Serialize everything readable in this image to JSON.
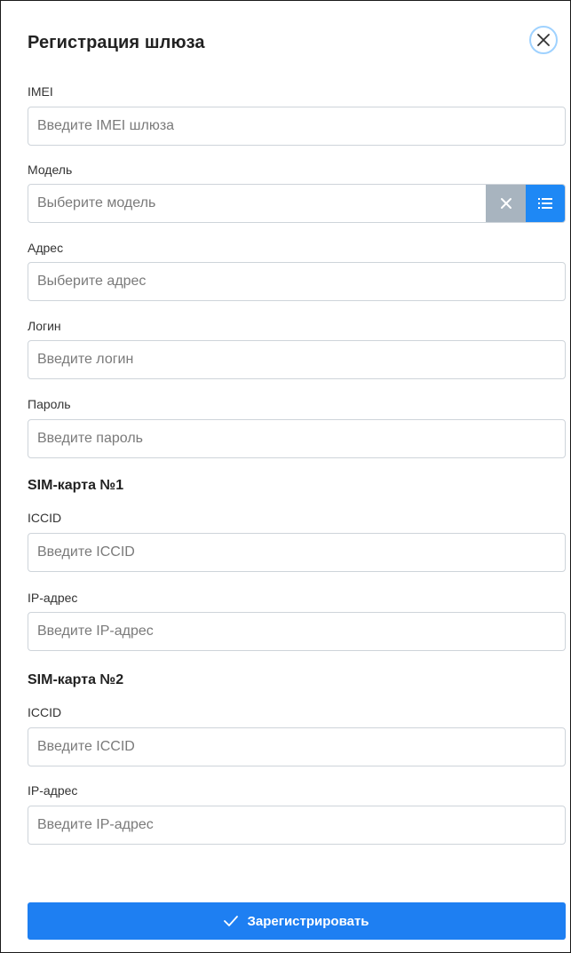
{
  "dialog": {
    "title": "Регистрация шлюза",
    "close_icon": "close-icon"
  },
  "fields": {
    "imei": {
      "label": "IMEI",
      "placeholder": "Введите IMEI шлюза",
      "value": ""
    },
    "model": {
      "label": "Модель",
      "placeholder": "Выберите модель",
      "clear_icon": "close-icon",
      "list_icon": "list-icon"
    },
    "address": {
      "label": "Адрес",
      "placeholder": "Выберите адрес",
      "value": ""
    },
    "login": {
      "label": "Логин",
      "placeholder": "Введите логин",
      "value": ""
    },
    "password": {
      "label": "Пароль",
      "placeholder": "Введите пароль",
      "value": ""
    }
  },
  "sim1": {
    "title": "SIM-карта №1",
    "iccid": {
      "label": "ICCID",
      "placeholder": "Введите ICCID",
      "value": ""
    },
    "ip": {
      "label": "IP-адрес",
      "placeholder": "Введите IP-адрес",
      "value": ""
    }
  },
  "sim2": {
    "title": "SIM-карта №2",
    "iccid": {
      "label": "ICCID",
      "placeholder": "Введите ICCID",
      "value": ""
    },
    "ip": {
      "label": "IP-адрес",
      "placeholder": "Введите IP-адрес",
      "value": ""
    }
  },
  "submit": {
    "label": "Зарегистрировать",
    "icon": "check-icon"
  },
  "colors": {
    "primary": "#1e7ff2",
    "select_clear_bg": "#a8b4bf",
    "select_list_bg": "#1e88f5",
    "close_border": "#9fd2ff"
  }
}
